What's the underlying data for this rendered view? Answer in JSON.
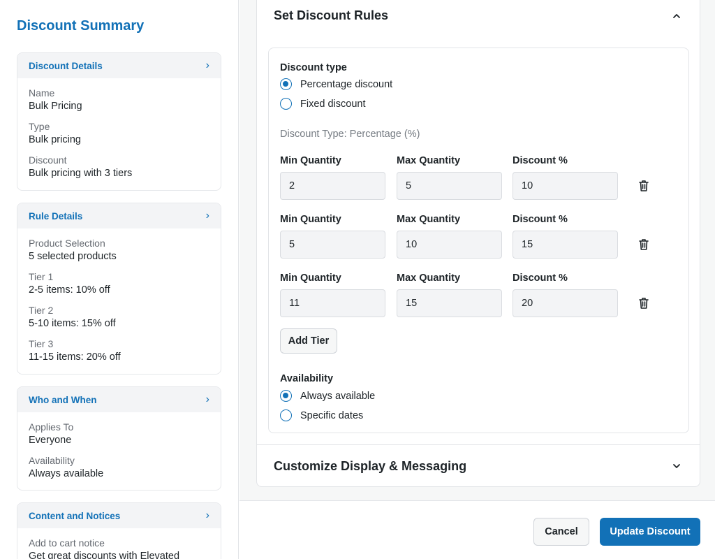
{
  "sidebar": {
    "title": "Discount Summary",
    "cards": [
      {
        "title": "Discount Details",
        "items": [
          {
            "label": "Name",
            "value": "Bulk Pricing"
          },
          {
            "label": "Type",
            "value": "Bulk pricing"
          },
          {
            "label": "Discount",
            "value": "Bulk pricing with 3 tiers"
          }
        ]
      },
      {
        "title": "Rule Details",
        "items": [
          {
            "label": "Product Selection",
            "value": "5 selected products"
          },
          {
            "label": "Tier 1",
            "value": "2-5 items: 10% off"
          },
          {
            "label": "Tier 2",
            "value": "5-10 items: 15% off"
          },
          {
            "label": "Tier 3",
            "value": "11-15 items: 20% off"
          }
        ]
      },
      {
        "title": "Who and When",
        "items": [
          {
            "label": "Applies To",
            "value": "Everyone"
          },
          {
            "label": "Availability",
            "value": "Always available"
          }
        ]
      },
      {
        "title": "Content and Notices",
        "items": [
          {
            "label": "Add to cart notice",
            "value": "Get great discounts with Elevated"
          }
        ]
      }
    ]
  },
  "rules": {
    "title": "Set Discount Rules",
    "discount_type": {
      "label": "Discount type",
      "options": [
        "Percentage discount",
        "Fixed discount"
      ],
      "selected": 0,
      "hint": "Discount Type: Percentage (%)"
    },
    "columns": [
      "Min Quantity",
      "Max Quantity",
      "Discount %"
    ],
    "tiers": [
      {
        "min": "2",
        "max": "5",
        "discount": "10"
      },
      {
        "min": "5",
        "max": "10",
        "discount": "15"
      },
      {
        "min": "11",
        "max": "15",
        "discount": "20"
      }
    ],
    "add_tier_label": "Add Tier",
    "availability": {
      "label": "Availability",
      "options": [
        "Always available",
        "Specific dates"
      ],
      "selected": 0
    }
  },
  "display": {
    "title": "Customize Display & Messaging"
  },
  "footer": {
    "cancel_label": "Cancel",
    "submit_label": "Update Discount"
  },
  "colors": {
    "accent": "#1271b7"
  }
}
